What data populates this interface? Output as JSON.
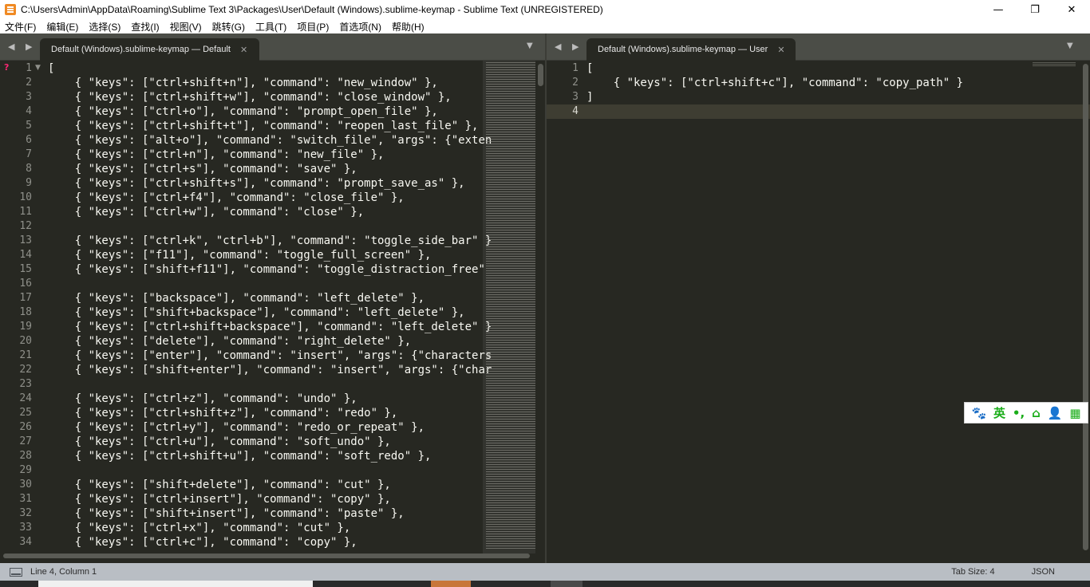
{
  "window": {
    "title": "C:\\Users\\Admin\\AppData\\Roaming\\Sublime Text 3\\Packages\\User\\Default (Windows).sublime-keymap - Sublime Text (UNREGISTERED)",
    "minimize": "—",
    "maximize": "❐",
    "close": "✕"
  },
  "menu": [
    "文件(F)",
    "编辑(E)",
    "选择(S)",
    "查找(I)",
    "视图(V)",
    "跳转(G)",
    "工具(T)",
    "项目(P)",
    "首选项(N)",
    "帮助(H)"
  ],
  "left_pane": {
    "nav": "◀ ▶",
    "tab_label": "Default (Windows).sublime-keymap — Default",
    "tab_close": "✕",
    "dropdown": "▼",
    "error_mark": "?",
    "fold_mark": "▼",
    "lines": [
      "[",
      "    { \"keys\": [\"ctrl+shift+n\"], \"command\": \"new_window\" },",
      "    { \"keys\": [\"ctrl+shift+w\"], \"command\": \"close_window\" },",
      "    { \"keys\": [\"ctrl+o\"], \"command\": \"prompt_open_file\" },",
      "    { \"keys\": [\"ctrl+shift+t\"], \"command\": \"reopen_last_file\" },",
      "    { \"keys\": [\"alt+o\"], \"command\": \"switch_file\", \"args\": {\"exten",
      "    { \"keys\": [\"ctrl+n\"], \"command\": \"new_file\" },",
      "    { \"keys\": [\"ctrl+s\"], \"command\": \"save\" },",
      "    { \"keys\": [\"ctrl+shift+s\"], \"command\": \"prompt_save_as\" },",
      "    { \"keys\": [\"ctrl+f4\"], \"command\": \"close_file\" },",
      "    { \"keys\": [\"ctrl+w\"], \"command\": \"close\" },",
      "",
      "    { \"keys\": [\"ctrl+k\", \"ctrl+b\"], \"command\": \"toggle_side_bar\" }",
      "    { \"keys\": [\"f11\"], \"command\": \"toggle_full_screen\" },",
      "    { \"keys\": [\"shift+f11\"], \"command\": \"toggle_distraction_free\"",
      "",
      "    { \"keys\": [\"backspace\"], \"command\": \"left_delete\" },",
      "    { \"keys\": [\"shift+backspace\"], \"command\": \"left_delete\" },",
      "    { \"keys\": [\"ctrl+shift+backspace\"], \"command\": \"left_delete\" }",
      "    { \"keys\": [\"delete\"], \"command\": \"right_delete\" },",
      "    { \"keys\": [\"enter\"], \"command\": \"insert\", \"args\": {\"characters",
      "    { \"keys\": [\"shift+enter\"], \"command\": \"insert\", \"args\": {\"char",
      "",
      "    { \"keys\": [\"ctrl+z\"], \"command\": \"undo\" },",
      "    { \"keys\": [\"ctrl+shift+z\"], \"command\": \"redo\" },",
      "    { \"keys\": [\"ctrl+y\"], \"command\": \"redo_or_repeat\" },",
      "    { \"keys\": [\"ctrl+u\"], \"command\": \"soft_undo\" },",
      "    { \"keys\": [\"ctrl+shift+u\"], \"command\": \"soft_redo\" },",
      "",
      "    { \"keys\": [\"shift+delete\"], \"command\": \"cut\" },",
      "    { \"keys\": [\"ctrl+insert\"], \"command\": \"copy\" },",
      "    { \"keys\": [\"shift+insert\"], \"command\": \"paste\" },",
      "    { \"keys\": [\"ctrl+x\"], \"command\": \"cut\" },",
      "    { \"keys\": [\"ctrl+c\"], \"command\": \"copy\" },"
    ],
    "line_numbers": [
      "1",
      "2",
      "3",
      "4",
      "5",
      "6",
      "7",
      "8",
      "9",
      "10",
      "11",
      "12",
      "13",
      "14",
      "15",
      "16",
      "17",
      "18",
      "19",
      "20",
      "21",
      "22",
      "23",
      "24",
      "25",
      "26",
      "27",
      "28",
      "29",
      "30",
      "31",
      "32",
      "33",
      "34"
    ]
  },
  "right_pane": {
    "nav": "◀ ▶",
    "tab_label": "Default (Windows).sublime-keymap — User",
    "tab_close": "✕",
    "dropdown": "▼",
    "lines": [
      "[",
      "    { \"keys\": [\"ctrl+shift+c\"], \"command\": \"copy_path\" }",
      "]",
      ""
    ],
    "line_numbers": [
      "1",
      "2",
      "3",
      "4"
    ],
    "current_line": 4
  },
  "ime_toolbar": {
    "items": [
      "🐾",
      "英",
      "•,",
      "⌂",
      "👤",
      "▦"
    ]
  },
  "status": {
    "position": "Line 4, Column 1",
    "tab_size": "Tab Size: 4",
    "syntax": "JSON"
  },
  "colors": {
    "editor_bg": "#272822",
    "tab_bar_bg": "#4b4d47",
    "status_bg": "#b9bec4",
    "text": "#f8f8f2",
    "ime_green": "#1aad19"
  }
}
